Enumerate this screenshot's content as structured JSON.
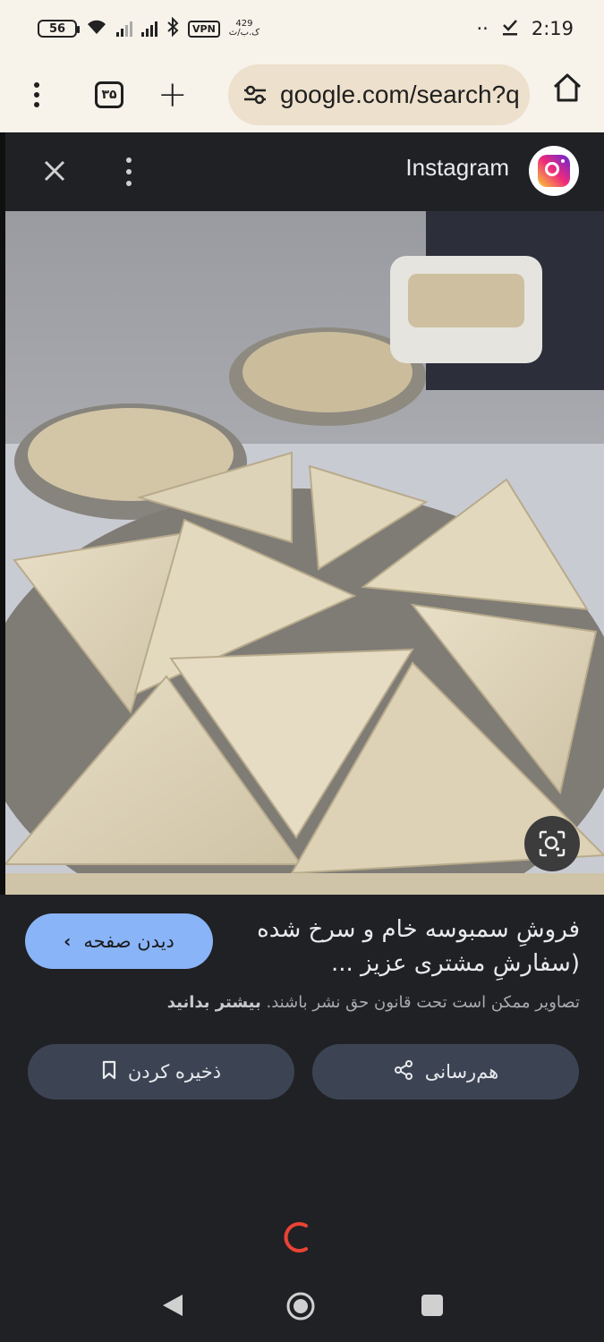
{
  "status_bar": {
    "battery": "56",
    "vpn": "VPN",
    "speed_value": "429",
    "speed_unit": "ک.ب/ث",
    "dots": "··",
    "time": "2:19"
  },
  "browser": {
    "tab_count": "۳۵",
    "url": "google.com/search?q"
  },
  "viewer": {
    "source": "Instagram",
    "visit_button": "دیدن صفحه",
    "title": "فروشِ سمبوسه خام و سرخ شده (سفارشِ مشتری عزیز ...",
    "copyright_text": "تصاویر ممکن است تحت قانون حق نشر باشند.",
    "learn_more": "بیشتر بدانید",
    "save_button": "ذخیره کردن",
    "share_button": "هم‌رسانی"
  },
  "colors": {
    "accent": "#8ab4f8",
    "spinner": "#ea4335",
    "background": "#202124"
  }
}
